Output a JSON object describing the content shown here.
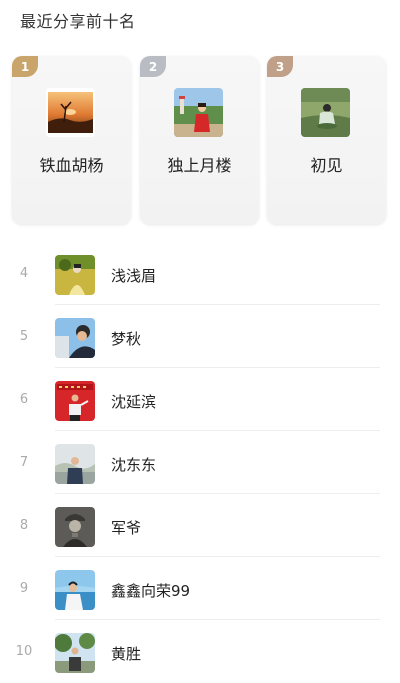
{
  "header": {
    "title": "最近分享前十名"
  },
  "top_three": [
    {
      "rank": "1",
      "name": "铁血胡杨",
      "avatar": "sunset-desert-tree-photo",
      "tag_color": "#c9a56b"
    },
    {
      "rank": "2",
      "name": "独上月楼",
      "avatar": "woman-red-outfit-garden-photo",
      "tag_color": "#b9bcc2"
    },
    {
      "rank": "3",
      "name": "初见",
      "avatar": "person-on-grassland-photo",
      "tag_color": "#c0a088"
    }
  ],
  "others": [
    {
      "rank": "4",
      "name": "浅浅眉",
      "avatar": "person-yellow-field-photo"
    },
    {
      "rank": "5",
      "name": "梦秋",
      "avatar": "man-black-cap-photo"
    },
    {
      "rank": "6",
      "name": "沈延滨",
      "avatar": "man-red-banner-photo"
    },
    {
      "rank": "7",
      "name": "沈东东",
      "avatar": "man-outdoor-photo"
    },
    {
      "rank": "8",
      "name": "军爷",
      "avatar": "vintage-soldier-portrait-photo"
    },
    {
      "rank": "9",
      "name": "鑫鑫向荣99",
      "avatar": "woman-by-sea-photo"
    },
    {
      "rank": "10",
      "name": "黄胜",
      "avatar": "man-under-trees-photo"
    }
  ]
}
